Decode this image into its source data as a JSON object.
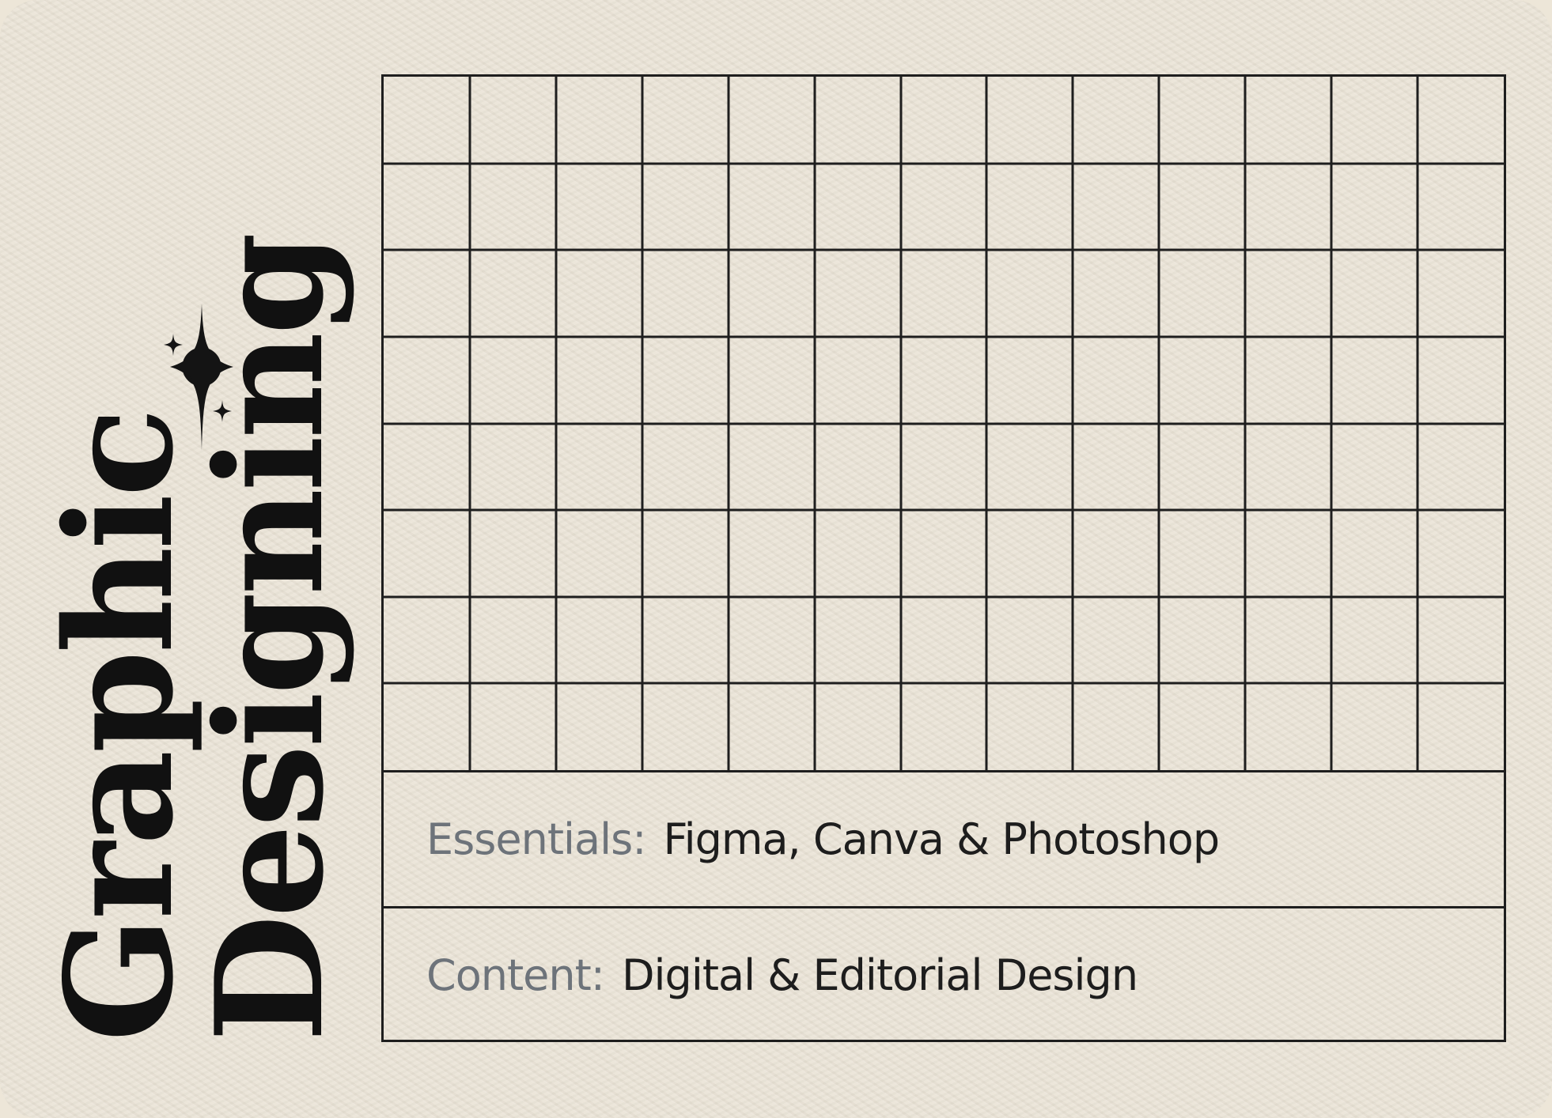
{
  "title": {
    "line1": "Graphic",
    "line2": "Designing"
  },
  "decoration": {
    "icon": "sparkle-icon"
  },
  "grid": {
    "columns": 13,
    "rows": 8
  },
  "info": {
    "essentials_label": "Essentials:",
    "essentials_value": "Figma, Canva & Photoshop",
    "content_label": "Content:",
    "content_value": "Digital & Editorial Design"
  },
  "colors": {
    "background": "#eae3d6",
    "ink": "#1e1e1e",
    "label": "#6d737a"
  }
}
